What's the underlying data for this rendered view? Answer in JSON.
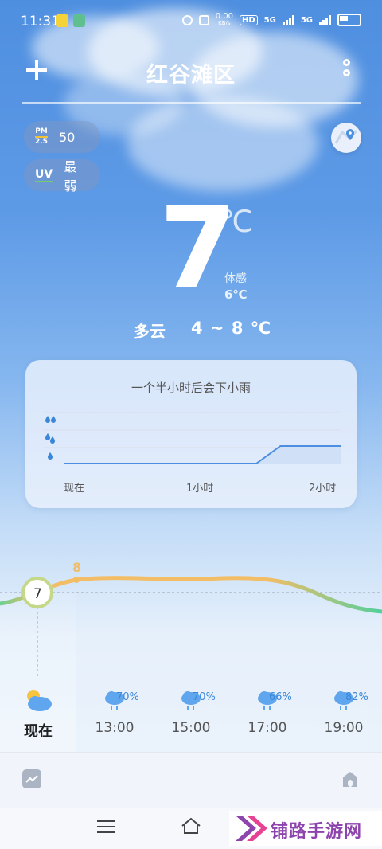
{
  "status_bar": {
    "time": "11:31",
    "network_speed": "0.00",
    "network_unit": "KB/s",
    "hd_label": "HD",
    "sim1": "5G",
    "sim2": "5G"
  },
  "header": {
    "title": "红谷滩区",
    "add_icon": "plus-icon",
    "menu_icon": "more-icon"
  },
  "air": {
    "pm_label_top": "PM",
    "pm_label_bottom": "2.5",
    "pm_value": "50",
    "uv_label": "UV",
    "uv_value": "最弱"
  },
  "current": {
    "temperature": "7",
    "unit": "℃",
    "feels_label": "体感",
    "feels_value": "6℃",
    "condition": "多云",
    "range": "4 ~ 8 ℃"
  },
  "precip_card": {
    "title": "一个半小时后会下小雨",
    "time_labels": [
      "现在",
      "1小时",
      "2小时"
    ],
    "series": [
      0,
      0,
      0,
      0,
      0,
      0,
      0,
      0,
      0,
      0,
      0,
      0,
      0,
      0,
      0,
      0,
      0,
      0.5,
      1,
      1,
      1,
      1,
      1,
      1
    ],
    "colors": {
      "line": "#4a8fe0",
      "fill": "#cfe0f7"
    }
  },
  "hourly": {
    "max_label": "8",
    "now_temp": "7",
    "items": [
      {
        "time": "现在",
        "precip": "",
        "icon": "partly-cloudy-icon"
      },
      {
        "time": "13:00",
        "precip": "70%",
        "icon": "rain-icon"
      },
      {
        "time": "15:00",
        "precip": "70%",
        "icon": "rain-icon"
      },
      {
        "time": "17:00",
        "precip": "66%",
        "icon": "rain-icon"
      },
      {
        "time": "19:00",
        "precip": "82%",
        "icon": "rain-icon"
      }
    ]
  },
  "watermark": {
    "text": "铺路手游网"
  }
}
